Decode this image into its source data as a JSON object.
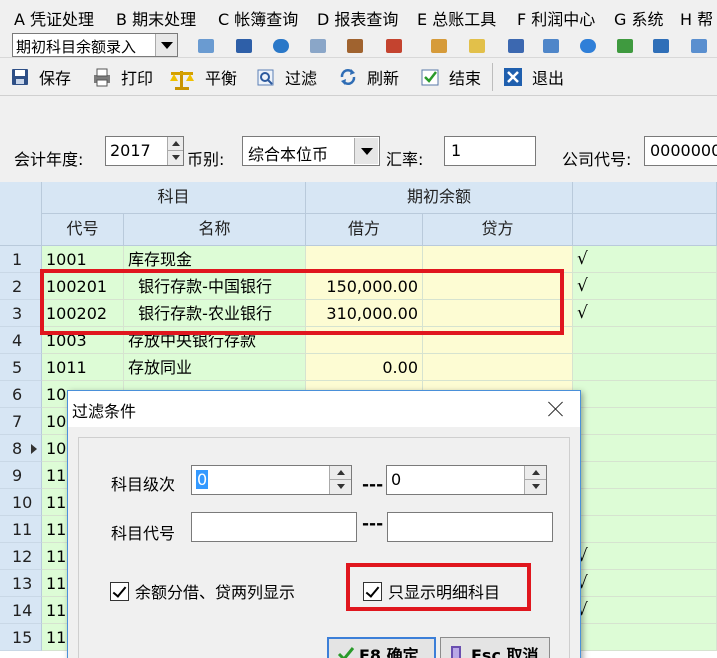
{
  "menu": [
    "A 凭证处理",
    "B 期末处理",
    "C 帐簿查询",
    "D 报表查询",
    "E 总账工具",
    "F 利润中心",
    "G 系统",
    "H 帮"
  ],
  "toolbar2": {
    "combo_value": "期初科目余额录入"
  },
  "toolbar": {
    "save": "保存",
    "print": "打印",
    "balance": "平衡",
    "filter": "过滤",
    "refresh": "刷新",
    "finish": "结束",
    "exit": "退出"
  },
  "form": {
    "year_label": "会计年度:",
    "year_value": "2017",
    "currency_label": "币别:",
    "currency_value": "综合本位币",
    "rate_label": "汇率:",
    "rate_value": "1",
    "company_label": "公司代号:",
    "company_value": "0000000"
  },
  "grid": {
    "group_subject": "科目",
    "group_balance": "期初余额",
    "col_code": "代号",
    "col_name": "名称",
    "col_debit": "借方",
    "col_credit": "贷方",
    "rows": [
      {
        "n": "1",
        "code": "1001",
        "name": "库存现金",
        "debit": "",
        "credit": "",
        "chk": "√"
      },
      {
        "n": "2",
        "code": "100201",
        "name": "  银行存款-中国银行",
        "debit": "150,000.00",
        "credit": "",
        "chk": "√"
      },
      {
        "n": "3",
        "code": "100202",
        "name": "  银行存款-农业银行",
        "debit": "310,000.00",
        "credit": "",
        "chk": "√"
      },
      {
        "n": "4",
        "code": "1003",
        "name": "存放中央银行存款",
        "debit": "",
        "credit": "",
        "chk": ""
      },
      {
        "n": "5",
        "code": "1011",
        "name": "存放同业",
        "debit": "0.00",
        "credit": "",
        "chk": ""
      },
      {
        "n": "6",
        "code": "10",
        "name": "",
        "debit": "",
        "credit": "",
        "chk": ""
      },
      {
        "n": "7",
        "code": "10",
        "name": "",
        "debit": "",
        "credit": "",
        "chk": ""
      },
      {
        "n": "8",
        "code": "10",
        "name": "",
        "debit": "",
        "credit": "",
        "chk": ""
      },
      {
        "n": "9",
        "code": "11",
        "name": "",
        "debit": "",
        "credit": "",
        "chk": ""
      },
      {
        "n": "10",
        "code": "11",
        "name": "",
        "debit": "",
        "credit": "",
        "chk": ""
      },
      {
        "n": "11",
        "code": "11",
        "name": "",
        "debit": "",
        "credit": "",
        "chk": ""
      },
      {
        "n": "12",
        "code": "11",
        "name": "",
        "debit": "",
        "credit": "",
        "chk": "√"
      },
      {
        "n": "13",
        "code": "11",
        "name": "",
        "debit": "",
        "credit": "",
        "chk": "√"
      },
      {
        "n": "14",
        "code": "11",
        "name": "",
        "debit": "",
        "credit": "",
        "chk": "√"
      },
      {
        "n": "15",
        "code": "11",
        "name": "",
        "debit": "",
        "credit": "",
        "chk": ""
      }
    ]
  },
  "dialog": {
    "title": "过滤条件",
    "level_label": "科目级次",
    "level_from": "0",
    "level_to": "0",
    "code_label": "科目代号",
    "code_from": "",
    "code_to": "",
    "dash": "---",
    "check_split": "余额分借、贷两列显示",
    "check_detail": "只显示明细科目",
    "ok": "F8 确定",
    "cancel": "Esc 取消"
  },
  "colors": {
    "accent_red": "#e0161e",
    "header_blue": "#d7e6f4",
    "cell_green": "#ddfcd6",
    "cell_yellow": "#fdfcd3"
  }
}
